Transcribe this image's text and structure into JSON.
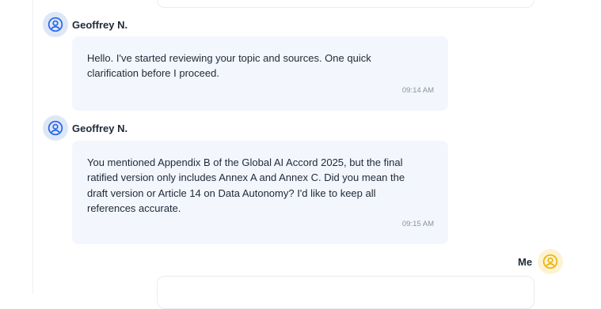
{
  "messages": [
    {
      "sender": "Geoffrey N.",
      "text": "Hello. I've started reviewing your topic and sources. One quick clarification before I proceed.",
      "time": "09:14 AM"
    },
    {
      "sender": "Geoffrey N.",
      "text": "You mentioned Appendix B of the Global AI Accord 2025, but the final ratified version only includes Annex A and Annex C. Did you mean the draft version or Article 14 on Data Autonomy? I'd like to keep all references accurate.",
      "time": "09:15 AM"
    }
  ],
  "self": {
    "label": "Me"
  },
  "icons": {
    "agent_avatar": "user-circle-icon",
    "self_avatar": "user-circle-icon"
  },
  "colors": {
    "agent_avatar": "#2563eb",
    "self_avatar": "#eab308",
    "bubble": "#f3f6fd"
  }
}
